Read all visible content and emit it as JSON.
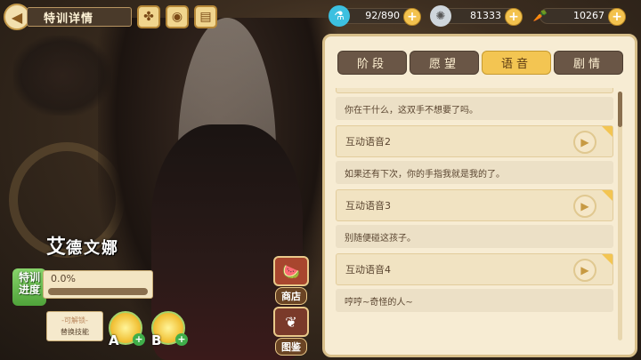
{
  "header": {
    "title": "特训详情"
  },
  "resources": {
    "stamina": {
      "value": "92/890",
      "fill": 0.1
    },
    "coins": {
      "value": "81333"
    },
    "carrots": {
      "value": "10267"
    }
  },
  "tabs": [
    {
      "label": "阶段",
      "active": false
    },
    {
      "label": "愿望",
      "active": false
    },
    {
      "label": "语音",
      "active": true
    },
    {
      "label": "剧情",
      "active": false
    }
  ],
  "voice_entries": [
    {
      "title": "",
      "text": "你在干什么，这双手不想要了吗。"
    },
    {
      "title": "互动语音2",
      "text": "如果还有下次，你的手指我就是我的了。"
    },
    {
      "title": "互动语音3",
      "text": "别随便碰这孩子。"
    },
    {
      "title": "互动语音4",
      "text": "哼哼~奇怪的人~"
    }
  ],
  "character": {
    "name_first": "艾",
    "name_rest": "德文娜"
  },
  "training": {
    "label_line1": "特训",
    "label_line2": "进度",
    "progress_text": "0.0%",
    "progress_fraction": 0.0
  },
  "unlock": {
    "line1": "-可解锁-",
    "line2": "替换技能"
  },
  "skills": [
    {
      "letter": "A"
    },
    {
      "letter": "B"
    }
  ],
  "side_buttons": {
    "shop": "商店",
    "gallery": "图鉴"
  },
  "colors": {
    "accent": "#f3c552",
    "tab_inactive": "#6a5646",
    "panel_bg": "#f7ecd3"
  }
}
